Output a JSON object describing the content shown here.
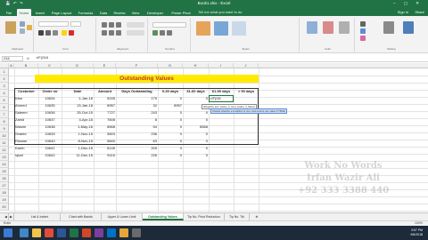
{
  "window": {
    "title": "Book1.xlsx - Excel",
    "controls": "– ▢ ✕",
    "quick_access": "💾 ↶ ↷"
  },
  "ribbon_tabs": [
    "File",
    "Home",
    "Insert",
    "Page Layout",
    "Formulas",
    "Data",
    "Review",
    "View",
    "Developer",
    "Power Pivot"
  ],
  "active_tab": "Home",
  "tell_me": "Tell me what you want to do",
  "sign_in": "Sign in",
  "share": "Share",
  "ribbon_groups": [
    "Clipboard",
    "Font",
    "Alignment",
    "Number",
    "Styles",
    "Cells",
    "Editing"
  ],
  "formula_bar": {
    "name_box": "G16",
    "fx": "fx",
    "formula": "=IF(G16"
  },
  "columns": [
    "A",
    "B",
    "C",
    "D",
    "E",
    "F",
    "G",
    "H",
    "I",
    "J"
  ],
  "rows": [
    "1",
    "2",
    "3",
    "4",
    "5",
    "6",
    "7",
    "8",
    "9",
    "10",
    "11",
    "12",
    "13",
    "14",
    "15",
    "16",
    "17",
    "18",
    "19",
    "20"
  ],
  "sheet": {
    "banner": "Outstanding Values",
    "headers": [
      "Customer",
      "Order no",
      "Date",
      "Amount",
      "Days Outstanding",
      "0-30 days",
      "31-60 days",
      "61-90 days",
      "> 90 days"
    ],
    "rows": [
      [
        "Irfan",
        "10634",
        "1-Jan-18",
        "5245",
        "175",
        "0",
        "0",
        "=IF(G6",
        ""
      ],
      [
        "Ahmed",
        "10635",
        "13-Jan-18",
        "8957",
        "32",
        "8957",
        "0",
        "",
        ""
      ],
      [
        "Saleem",
        "10636",
        "25-Oct-15",
        "7727",
        "243",
        "0",
        "0",
        "",
        ""
      ],
      [
        "Zahid",
        "10637",
        "4-Apr-16",
        "7608",
        "8",
        "0",
        "0",
        "",
        ""
      ],
      [
        "Wasim",
        "10638",
        "1-May-16",
        "8568",
        "54",
        "0",
        "8568",
        "",
        ""
      ],
      [
        "Shahid",
        "10639",
        "1-Nov-15",
        "5803",
        "236",
        "0",
        "0",
        "",
        ""
      ],
      [
        "Rizwan",
        "10640",
        "8-Nov-15",
        "5840",
        "63",
        "0",
        "0",
        "",
        ""
      ],
      [
        "Karim",
        "10641",
        "1-Dec-15",
        "8145",
        "205",
        "0",
        "0",
        "",
        ""
      ],
      [
        "Iqbal",
        "10642",
        "11-Dec-15",
        "9416",
        "226",
        "0",
        "0",
        "",
        ""
      ]
    ],
    "tooltip_1": "IF(logical_test, [value_if_true], [value_if_false])",
    "tooltip_2": "Checks whether a condition is met, and returns one value if TRUE"
  },
  "watermark": {
    "line1": "Work No Words",
    "line2": "Irfan Wazir Ali",
    "line3": "+92 333 3388 440"
  },
  "sheet_tabs": [
    "List & Indent",
    "Chart with Bands",
    "Upper & Lower Limit",
    "Outstanding Values",
    "Tip No. Pivot Reduction",
    "Tip No. Tbl"
  ],
  "active_sheet": "Outstanding Values",
  "status": {
    "mode": "Enter",
    "zoom": "100%"
  },
  "clock": {
    "time": "3:57 PM",
    "date": "9/6/2018"
  },
  "colors": {
    "excel_green": "#217346",
    "banner_yellow": "#ffea00",
    "banner_text": "#c0392b"
  }
}
